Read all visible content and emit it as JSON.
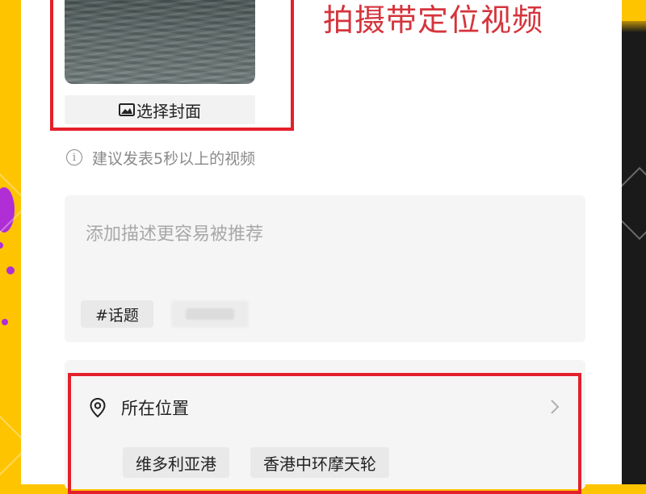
{
  "cover": {
    "select_label": "选择封面",
    "icon": "image-icon"
  },
  "headline": "拍摄带定位视频",
  "tip": {
    "icon": "info-icon",
    "text": "建议发表5秒以上的视频"
  },
  "description": {
    "placeholder": "添加描述更容易被推荐",
    "tags": [
      "#话题"
    ]
  },
  "location": {
    "icon": "location-pin-icon",
    "label": "所在位置",
    "chevron": "chevron-right-icon",
    "suggestions": [
      "维多利亚港",
      "香港中环摩天轮"
    ]
  },
  "colors": {
    "highlight": "#e3202a",
    "headline": "#d5343c",
    "background_accent": "#ffc400",
    "panel": "#ffffff"
  }
}
